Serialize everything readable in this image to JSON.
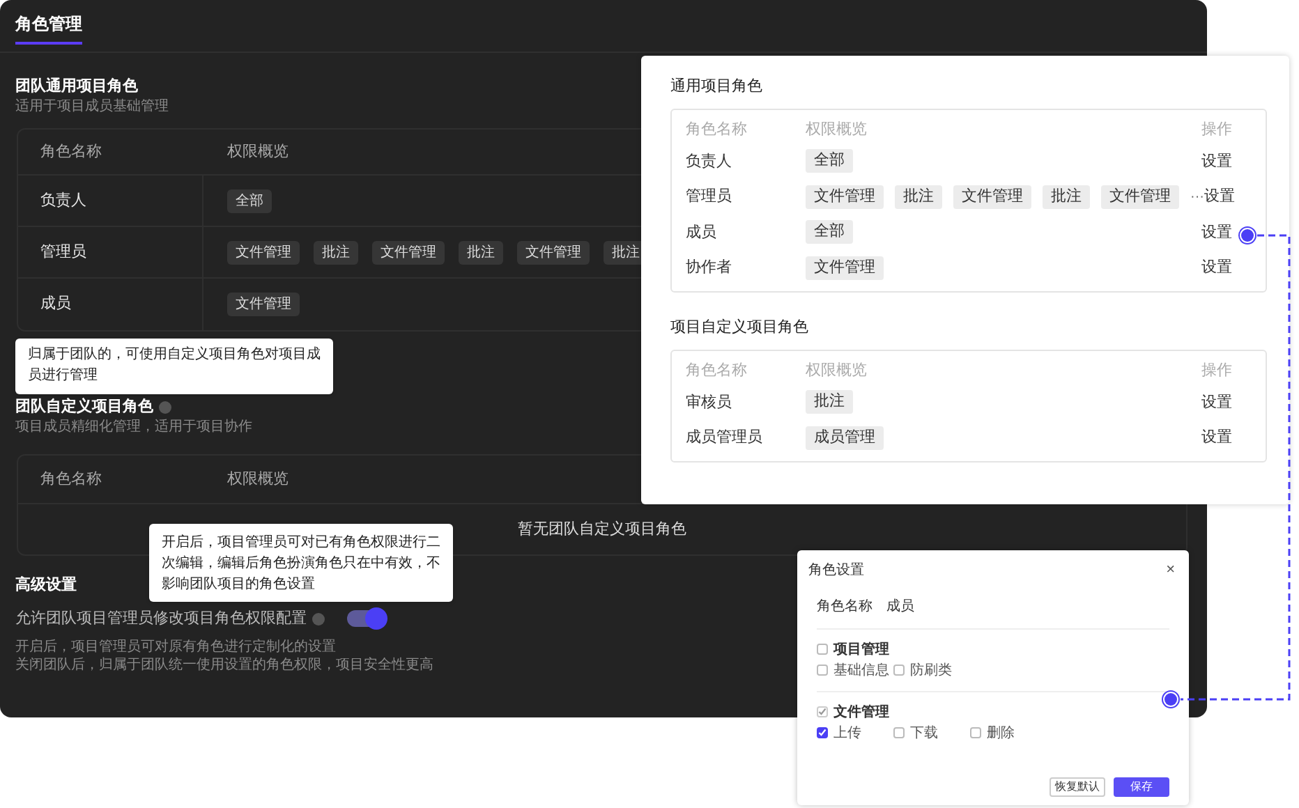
{
  "settings_panel": {
    "tab": {
      "label": "角色管理",
      "selected": true
    },
    "general_section": {
      "title": "团队通用项目角色",
      "subtitle": "适用于项目成员基础管理",
      "columns": [
        "角色名称",
        "权限概览"
      ],
      "rows": [
        {
          "name": "负责人",
          "permissions": [
            "全部"
          ]
        },
        {
          "name": "管理员",
          "permissions": [
            "文件管理",
            "批注",
            "文件管理",
            "批注",
            "文件管理",
            "批注"
          ]
        },
        {
          "name": "成员",
          "permissions": [
            "文件管理"
          ]
        }
      ]
    },
    "custom_tooltip": "归属于团队的，可使用自定义项目角色对项目成员进行管理",
    "custom_section": {
      "title": "团队自定义项目角色",
      "subtitle": "项目成员精细化管理，适用于项目协作",
      "columns": [
        "角色名称",
        "权限概览"
      ],
      "empty_text": "暂无团队自定义项目角色"
    },
    "advanced": {
      "title": "高级设置",
      "toggle_label": "允许团队项目管理员修改项目角色权限配置",
      "on": true,
      "tooltip": "开启后，项目管理员可对已有角色权限进行二次编辑，编辑后角色扮演角色只在中有效，不影响团队项目的角色设置",
      "notes": [
        "开启后，项目管理员可对原有角色进行定制化的设置",
        "关闭团队后，归属于团队统一使用设置的角色权限，项目安全性更高"
      ]
    }
  },
  "project_panel": {
    "sections": [
      {
        "title": "通用项目角色",
        "columns": [
          "角色名称",
          "权限概览",
          "操作"
        ],
        "rows": [
          {
            "name": "负责人",
            "permissions": [
              "全部"
            ],
            "action": "设置"
          },
          {
            "name": "管理员",
            "permissions": [
              "文件管理",
              "批注",
              "文件管理",
              "批注",
              "文件管理"
            ],
            "more": "···",
            "action": "设置"
          },
          {
            "name": "成员",
            "permissions": [
              "全部"
            ],
            "action": "设置"
          },
          {
            "name": "协作者",
            "permissions": [
              "文件管理"
            ],
            "action": "设置"
          }
        ]
      },
      {
        "title": "项目自定义项目角色",
        "columns": [
          "角色名称",
          "权限概览",
          "操作"
        ],
        "rows": [
          {
            "name": "审核员",
            "permissions": [
              "批注"
            ],
            "action": "设置"
          },
          {
            "name": "成员管理员",
            "permissions": [
              "成员管理"
            ],
            "action": "设置"
          }
        ]
      }
    ]
  },
  "dialog": {
    "title": "角色设置",
    "close": "×",
    "role_label": "角色名称",
    "role_value": "成员",
    "groups": [
      {
        "label": "项目管理",
        "checked": false,
        "options": [
          {
            "label": "基础信息",
            "checked": false
          },
          {
            "label": "防刷类",
            "checked": false
          }
        ]
      },
      {
        "label": "文件管理",
        "checked": true,
        "options": [
          {
            "label": "上传",
            "checked": true
          },
          {
            "label": "下载",
            "checked": false
          },
          {
            "label": "删除",
            "checked": false
          }
        ]
      }
    ],
    "buttons": [
      {
        "label": "恢复默认",
        "kind": "secondary"
      },
      {
        "label": "保存",
        "kind": "primary"
      }
    ]
  }
}
